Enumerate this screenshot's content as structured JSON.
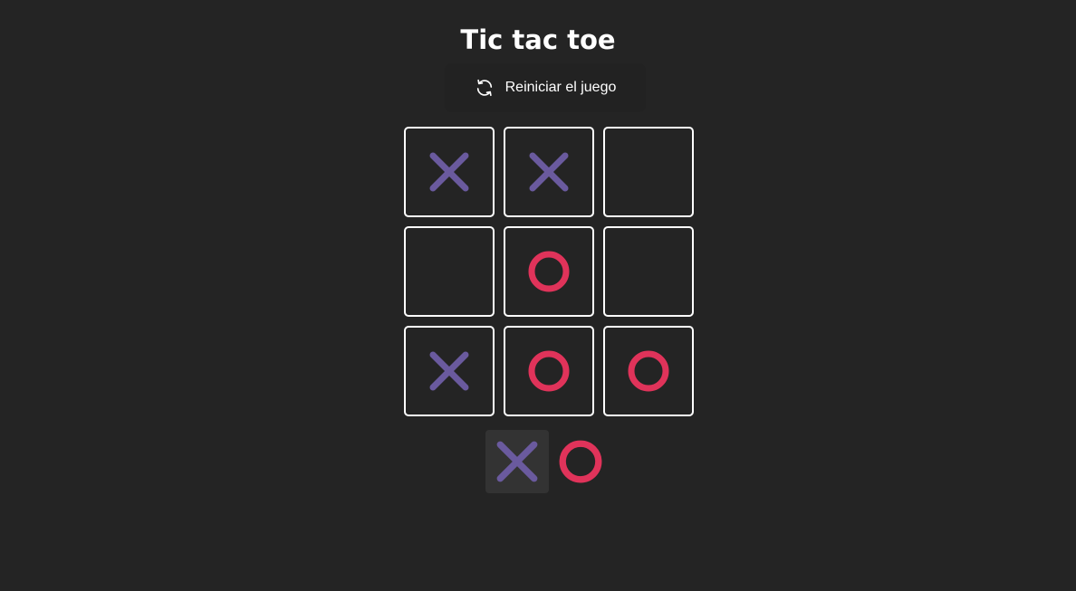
{
  "header": {
    "title": "Tic tac toe"
  },
  "reset": {
    "label": "Reiniciar el juego",
    "icon": "refresh-icon"
  },
  "board": {
    "cells": [
      "X",
      "X",
      "",
      "",
      "O",
      "",
      "X",
      "O",
      "O"
    ]
  },
  "turn": {
    "current": "X",
    "players": [
      "X",
      "O"
    ]
  },
  "colors": {
    "background": "#242424",
    "x_mark": "#6a5a9e",
    "o_mark": "#e0335a",
    "cell_border": "#ffffff",
    "active_turn_bg": "#333333"
  }
}
